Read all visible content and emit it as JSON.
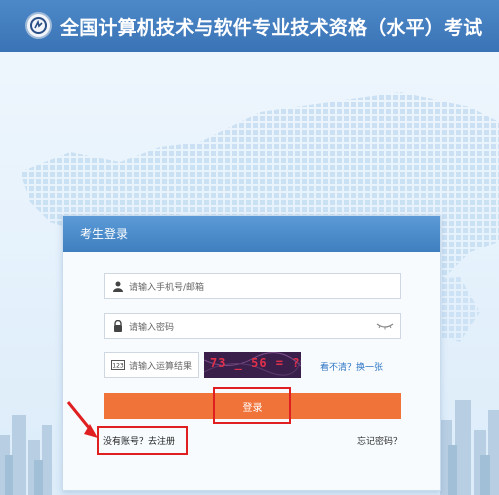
{
  "header": {
    "title": "全国计算机技术与软件专业技术资格（水平）考试"
  },
  "login": {
    "panel_title": "考生登录",
    "username_placeholder": "请输入手机号/邮箱",
    "password_placeholder": "请输入密码",
    "captcha_placeholder": "请输入运算结果",
    "captcha_text": "73 _ 56 = ?",
    "refresh_label": "看不清？换一张",
    "login_button": "登录",
    "register_link": "没有账号？去注册",
    "forgot_link": "忘记密码？"
  },
  "icons": {
    "logo": "exam-logo-icon",
    "user": "user-icon",
    "lock": "lock-icon",
    "captcha_badge": "123-icon",
    "eye": "eye-closed-icon"
  },
  "colors": {
    "header_bg": "#3f7bbd",
    "panel_header_bg": "#4a8bcc",
    "login_button_bg": "#f0733a",
    "highlight_red": "#e02020",
    "link_blue": "#2f76c4"
  }
}
